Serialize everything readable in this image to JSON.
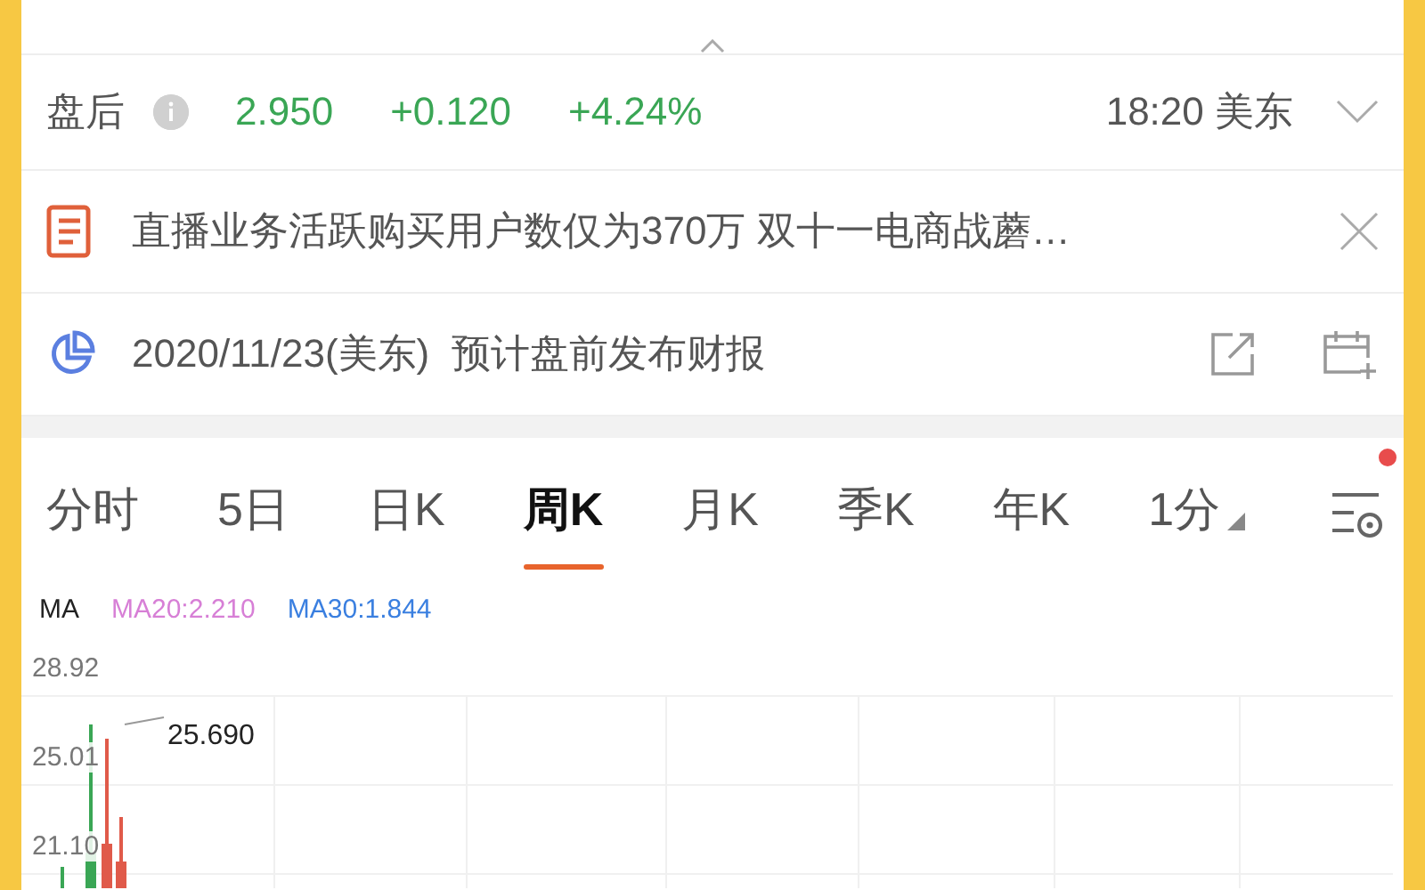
{
  "after_hours": {
    "label": "盘后",
    "price": "2.950",
    "change": "+0.120",
    "change_pct": "+4.24%",
    "time": "18:20 美东"
  },
  "news": {
    "text": "直播业务活跃购买用户数仅为370万 双十一电商战蘑…"
  },
  "earnings": {
    "text": "2020/11/23(美东)  预计盘前发布财报"
  },
  "tabs": [
    {
      "label": "分时",
      "selected": false
    },
    {
      "label": "5日",
      "selected": false
    },
    {
      "label": "日K",
      "selected": false
    },
    {
      "label": "周K",
      "selected": true
    },
    {
      "label": "月K",
      "selected": false
    },
    {
      "label": "季K",
      "selected": false
    },
    {
      "label": "年K",
      "selected": false
    },
    {
      "label": "1分",
      "selected": false
    }
  ],
  "settings_badge": true,
  "ma_legend": [
    {
      "label": "MA",
      "color": "#222222"
    },
    {
      "label": "MA20:2.210",
      "color": "#d77fd6"
    },
    {
      "label": "MA30:1.844",
      "color": "#3a7fe0"
    }
  ],
  "chart": {
    "y_labels": [
      "28.92",
      "25.01",
      "21.10"
    ],
    "high_label": "25.690"
  }
}
